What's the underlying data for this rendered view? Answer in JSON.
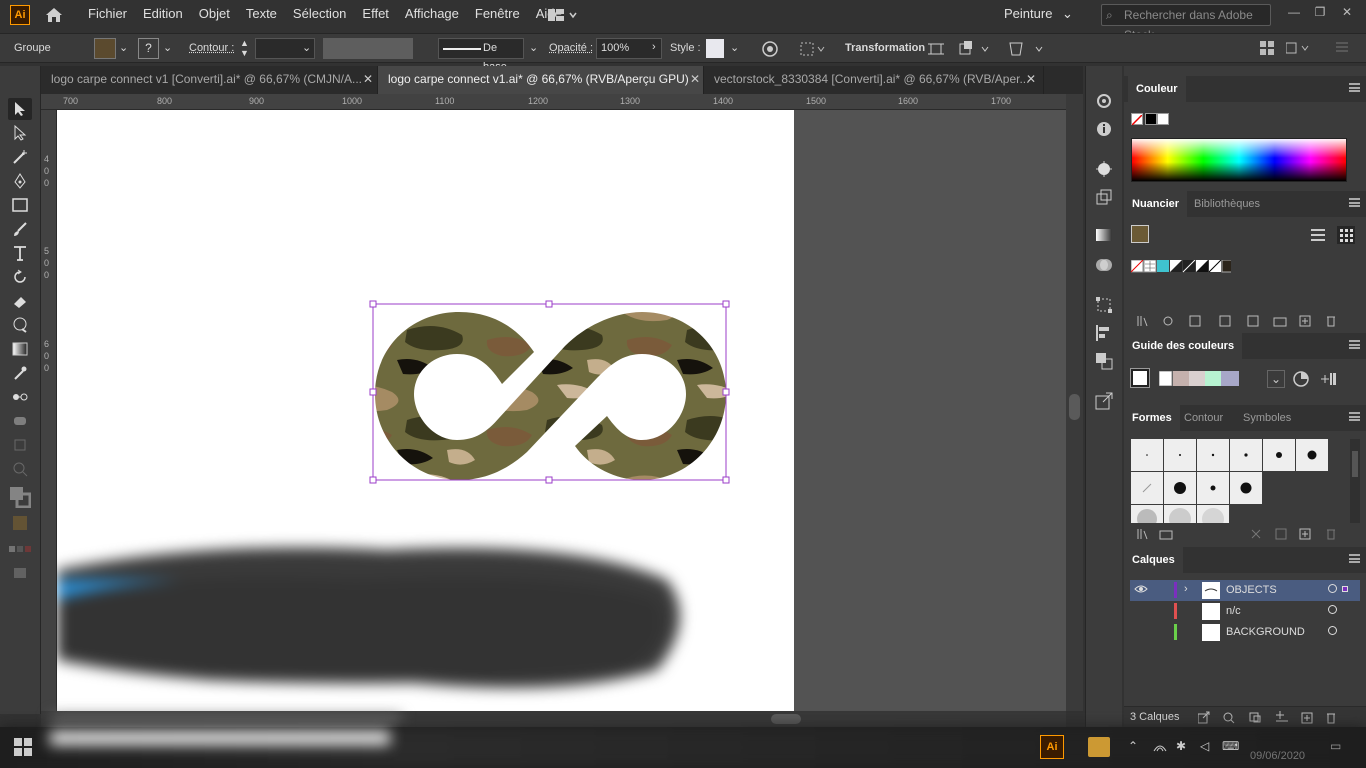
{
  "app": {
    "logo": "Ai"
  },
  "menu": [
    "Fichier",
    "Edition",
    "Objet",
    "Texte",
    "Sélection",
    "Effet",
    "Affichage",
    "Fenêtre",
    "Aide"
  ],
  "workspace": "Peinture",
  "search_placeholder": "Rechercher dans Adobe Stock",
  "control": {
    "selection_type": "Groupe",
    "stroke_label": "Contour :",
    "stroke_style": "De base",
    "opacity_label": "Opacité :",
    "opacity_value": "100%",
    "style_label": "Style :",
    "transform_label": "Transformation"
  },
  "tabs": [
    {
      "label": "logo carpe connect v1 [Converti].ai* @ 66,67% (CMJN/A..."
    },
    {
      "label": "logo carpe connect v1.ai* @ 66,67% (RVB/Aperçu GPU)"
    },
    {
      "label": "vectorstock_8330384 [Converti].ai* @ 66,67% (RVB/Aper..."
    }
  ],
  "ruler_h": [
    "700",
    "800",
    "900",
    "1000",
    "1100",
    "1200",
    "1300",
    "1400",
    "1500",
    "1600",
    "1700"
  ],
  "ruler_v": [
    "4",
    "0",
    "0",
    "5",
    "0",
    "0",
    "6",
    "0",
    "0"
  ],
  "panels": {
    "color": {
      "title": "Couleur"
    },
    "swatches": {
      "tabs": [
        "Nuancier",
        "Bibliothèques"
      ]
    },
    "color_guide": {
      "title": "Guide des couleurs"
    },
    "brushes": {
      "tabs": [
        "Formes",
        "Contour",
        "Symboles"
      ]
    },
    "layers": {
      "title": "Calques",
      "items": [
        {
          "name": "OBJECTS",
          "color": "#7b2fbf"
        },
        {
          "name": "n/c",
          "color": "#e05050"
        },
        {
          "name": "BACKGROUND",
          "color": "#6ad04a"
        }
      ],
      "count": "3 Calques"
    }
  },
  "taskbar": {
    "date": "09/06/2020",
    "app_icon": "Ai"
  },
  "colors": {
    "selection": "#9b3ec8",
    "accent": "#ff9a00"
  }
}
